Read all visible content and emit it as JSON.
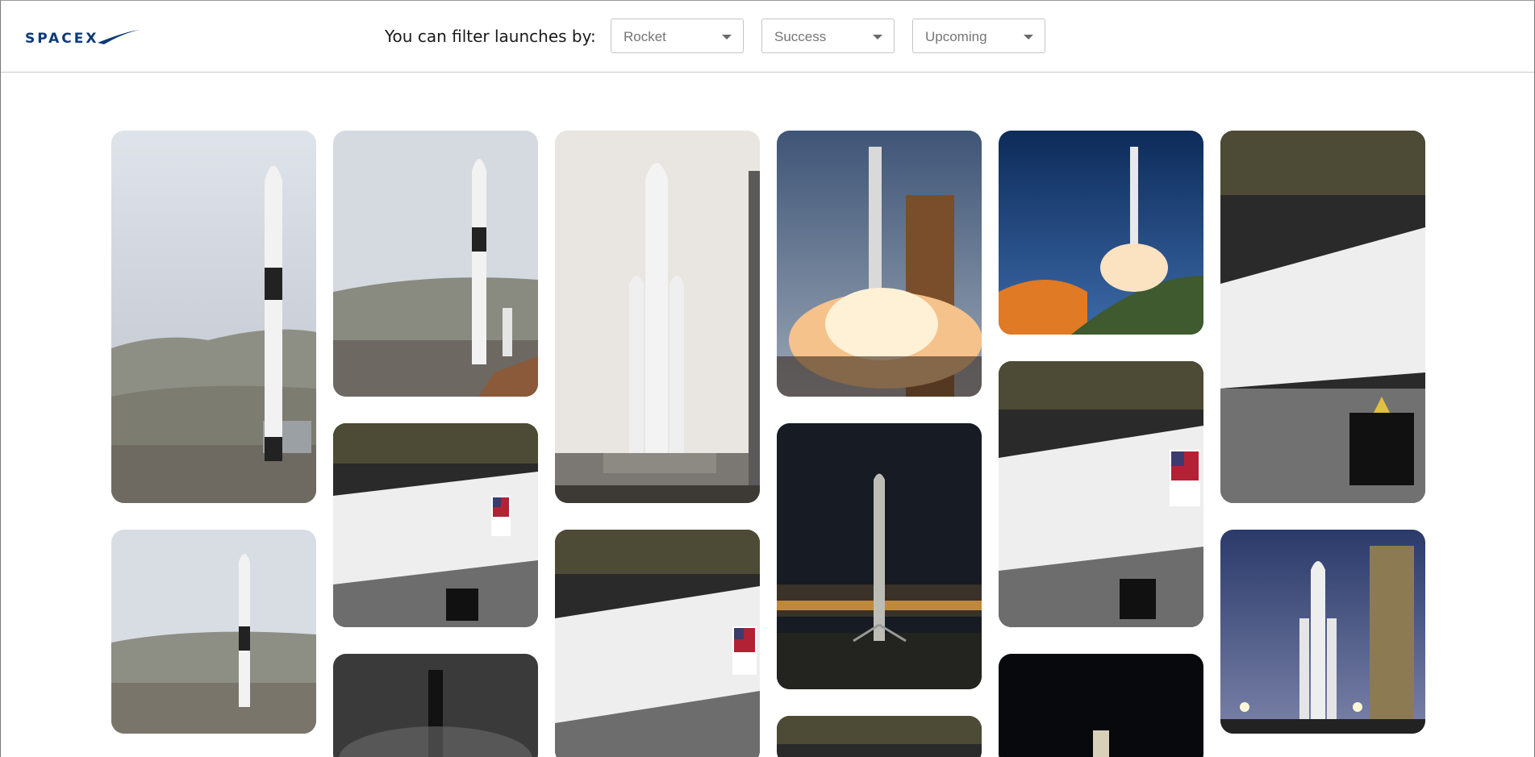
{
  "header": {
    "logo_text": "SPACEX",
    "filter_label": "You can filter launches by:",
    "filters": [
      {
        "name": "rocket",
        "value": "Rocket"
      },
      {
        "name": "success",
        "value": "Success"
      },
      {
        "name": "upcoming",
        "value": "Upcoming"
      }
    ]
  },
  "gallery": {
    "items": [
      {
        "icon": "rocket-on-pad-photo"
      },
      {
        "icon": "rocket-on-pad-photo"
      },
      {
        "icon": "rocket-on-pad-photo"
      },
      {
        "icon": "rocket-hangar-photo"
      },
      {
        "icon": "rocket-night-photo"
      },
      {
        "icon": "falcon-heavy-photo"
      },
      {
        "icon": "rocket-hangar-photo"
      },
      {
        "icon": "rocket-launch-photo"
      },
      {
        "icon": "rocket-night-landing-photo"
      },
      {
        "icon": "rocket-hangar-photo"
      },
      {
        "icon": "rocket-launch-photo"
      },
      {
        "icon": "rocket-hangar-photo"
      },
      {
        "icon": "rocket-night-photo"
      },
      {
        "icon": "rocket-hangar-photo"
      },
      {
        "icon": "falcon-heavy-night-photo"
      }
    ]
  },
  "colors": {
    "logo": "#0b3a7a",
    "border": "#c4c4c4"
  }
}
